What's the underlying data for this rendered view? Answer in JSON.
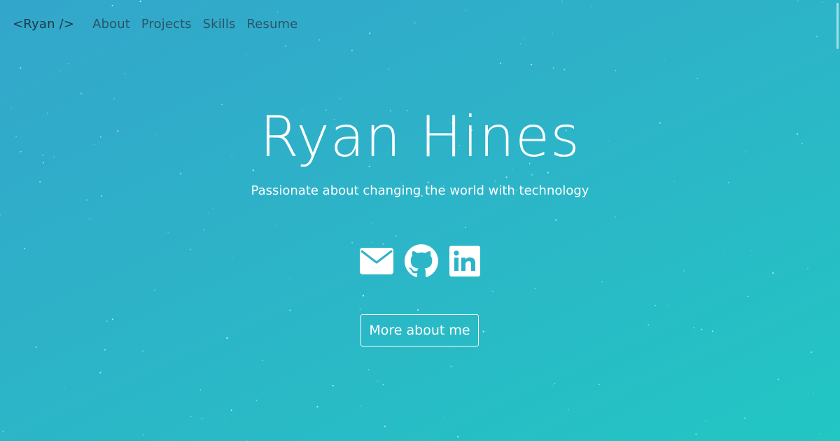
{
  "nav": {
    "brand": "<Ryan />",
    "links": [
      "About",
      "Projects",
      "Skills",
      "Resume"
    ]
  },
  "hero": {
    "name": "Ryan Hines",
    "tagline": "Passionate about changing the world with technology",
    "cta_label": "More about me"
  },
  "socials": [
    {
      "icon": "envelope-icon"
    },
    {
      "icon": "github-icon"
    },
    {
      "icon": "linkedin-icon"
    }
  ],
  "colors": {
    "gradient_start": "#33a6cb",
    "gradient_end": "#22c6c3",
    "text": "#ffffff",
    "nav_text": "#2a5566"
  }
}
